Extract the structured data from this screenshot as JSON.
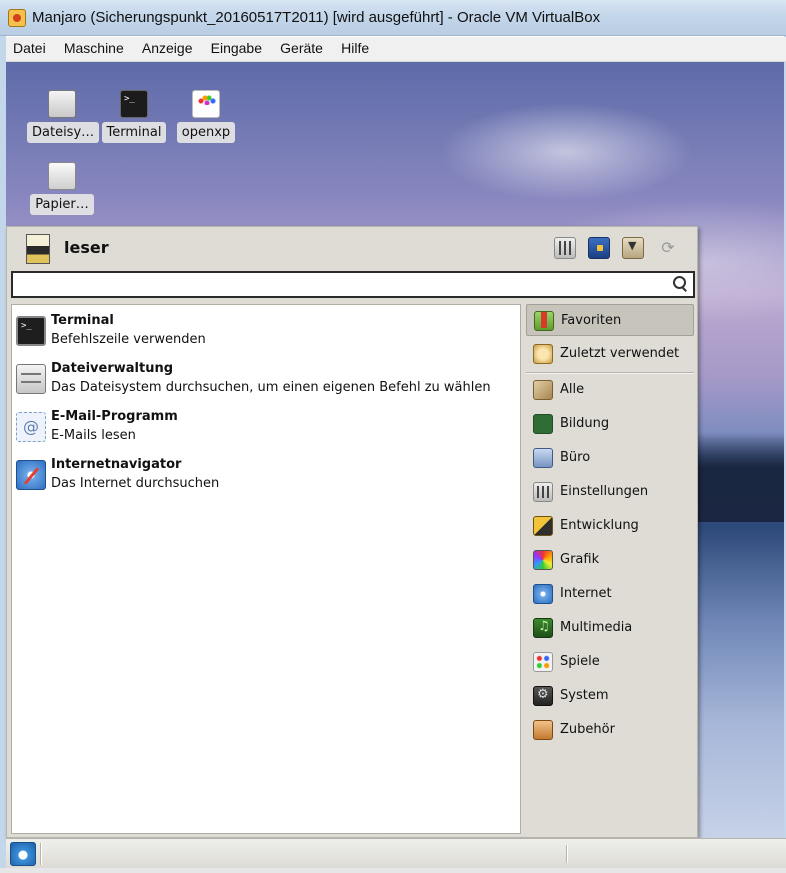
{
  "window": {
    "title": "Manjaro (Sicherungspunkt_20160517T2011) [wird ausgeführt] - Oracle VM VirtualBox",
    "icon": "virtualbox-icon"
  },
  "menubar": {
    "items": [
      "Datei",
      "Maschine",
      "Anzeige",
      "Eingabe",
      "Geräte",
      "Hilfe"
    ]
  },
  "desktop": {
    "icons": [
      {
        "label": "Dateisy…",
        "icon": "drive-icon"
      },
      {
        "label": "Terminal",
        "icon": "terminal-icon"
      },
      {
        "label": "openxp",
        "icon": "openxp-icon"
      },
      {
        "label": "Papier…",
        "icon": "trash-icon"
      }
    ]
  },
  "appmenu": {
    "username": "leser",
    "header_buttons": [
      "settings-icon",
      "lock-screen-icon",
      "logout-icon",
      "refresh-icon"
    ],
    "search": {
      "value": "",
      "placeholder": ""
    },
    "favorites": [
      {
        "name": "Terminal",
        "description": "Befehlszeile verwenden",
        "icon": "terminal-icon"
      },
      {
        "name": "Dateiverwaltung",
        "description": "Das Dateisystem durchsuchen, um einen eigenen Befehl zu wählen",
        "icon": "file-manager-icon"
      },
      {
        "name": "E-Mail-Programm",
        "description": "E-Mails lesen",
        "icon": "mail-icon"
      },
      {
        "name": "Internetnavigator",
        "description": "Das Internet durchsuchen",
        "icon": "web-browser-icon"
      }
    ],
    "categories_top": [
      {
        "label": "Favoriten",
        "icon": "favorites-icon",
        "active": true
      },
      {
        "label": "Zuletzt verwendet",
        "icon": "recent-icon",
        "active": false
      }
    ],
    "categories": [
      {
        "label": "Alle",
        "icon": "all-icon"
      },
      {
        "label": "Bildung",
        "icon": "education-icon"
      },
      {
        "label": "Büro",
        "icon": "office-icon"
      },
      {
        "label": "Einstellungen",
        "icon": "settings-icon"
      },
      {
        "label": "Entwicklung",
        "icon": "development-icon"
      },
      {
        "label": "Grafik",
        "icon": "graphics-icon"
      },
      {
        "label": "Internet",
        "icon": "internet-icon"
      },
      {
        "label": "Multimedia",
        "icon": "multimedia-icon"
      },
      {
        "label": "Spiele",
        "icon": "games-icon"
      },
      {
        "label": "System",
        "icon": "system-icon"
      },
      {
        "label": "Zubehör",
        "icon": "accessories-icon"
      }
    ]
  },
  "colors": {
    "menu_background": "#dedcd5",
    "active_category": "#c7c4bc",
    "titlebar": "#c3d6ea"
  }
}
